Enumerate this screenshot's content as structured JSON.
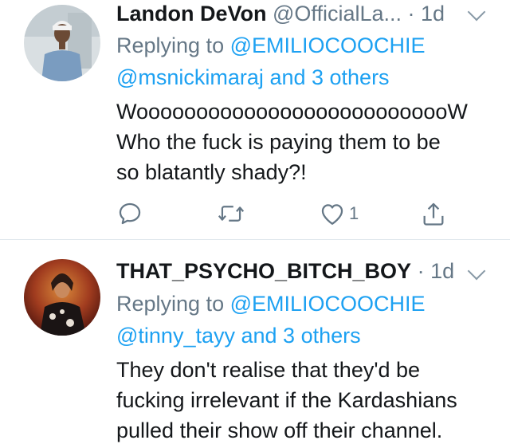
{
  "tweets": [
    {
      "name": "Landon DeVon",
      "handle": "@OfficialLa...",
      "dot": " · ",
      "time": "1d",
      "replying_prefix": "Replying to",
      "replying_mentions": "@EMILIOCOOCHIE",
      "replying_line2_mention": "@msnickimaraj",
      "replying_line2_suffix": "and 3 others",
      "body_lines": [
        "WooooooooooooooooooooooooooW",
        "Who the fuck is paying them to be",
        "so blatantly shady?!"
      ],
      "like_count": "1",
      "avatar_colors": {
        "bg": "#cfd6d9",
        "shirt": "#7a9cc0",
        "skin": "#6b4a35"
      }
    },
    {
      "name": "THAT_PSYCHO_BITCH_BOY",
      "handle": "",
      "dot": " · ",
      "time": "1d",
      "replying_prefix": "Replying to",
      "replying_mentions": "@EMILIOCOOCHIE",
      "replying_line2_mention": "@tinny_tayy",
      "replying_line2_suffix": "and 3 others",
      "body_lines": [
        "They don't realise that they'd be",
        "fucking irrelevant if the Kardashians",
        "pulled their show off their channel."
      ],
      "like_count": "",
      "avatar_colors": {
        "bg": "#8a2a1c",
        "figure": "#1a1414",
        "glow": "#d9893a"
      }
    }
  ],
  "icons": {
    "reply": "reply-icon",
    "retweet": "retweet-icon",
    "like": "heart-icon",
    "share": "share-icon",
    "caret": "chevron-down-icon"
  },
  "colors": {
    "text": "#14171a",
    "secondary": "#657786",
    "link": "#1da1f2",
    "divider": "#e1e8ed"
  }
}
